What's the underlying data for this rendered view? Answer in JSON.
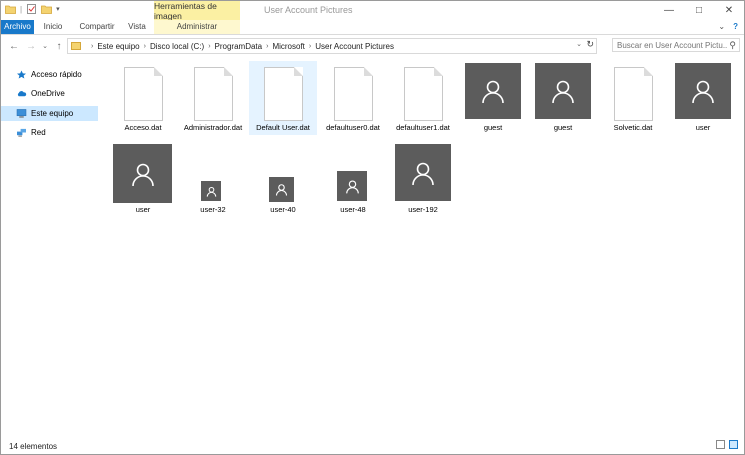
{
  "window": {
    "title": "User Account Pictures",
    "context_tab_header": "Herramientas de imagen"
  },
  "ribbon": {
    "tabs": [
      {
        "label": "Archivo"
      },
      {
        "label": "Inicio"
      },
      {
        "label": "Compartir"
      },
      {
        "label": "Vista"
      },
      {
        "label": "Administrar"
      }
    ]
  },
  "address": {
    "crumbs": [
      "Este equipo",
      "Disco local (C:)",
      "ProgramData",
      "Microsoft",
      "User Account Pictures"
    ]
  },
  "search": {
    "placeholder": "Buscar en User Account Pictu..."
  },
  "sidebar": {
    "items": [
      {
        "label": "Acceso rápido",
        "icon": "star-icon",
        "color": "#1979ca"
      },
      {
        "label": "OneDrive",
        "icon": "cloud-icon",
        "color": "#1979ca"
      },
      {
        "label": "Este equipo",
        "icon": "computer-icon",
        "color": "#3c8fd8"
      },
      {
        "label": "Red",
        "icon": "network-icon",
        "color": "#3c8fd8"
      }
    ]
  },
  "files": [
    {
      "name": "Acceso.dat",
      "kind": "document"
    },
    {
      "name": "Administrador.dat",
      "kind": "document"
    },
    {
      "name": "Default User.dat",
      "kind": "document"
    },
    {
      "name": "defaultuser0.dat",
      "kind": "document"
    },
    {
      "name": "defaultuser1.dat",
      "kind": "document"
    },
    {
      "name": "guest",
      "kind": "avatar"
    },
    {
      "name": "guest",
      "kind": "avatar"
    },
    {
      "name": "Solvetic.dat",
      "kind": "document"
    },
    {
      "name": "user",
      "kind": "avatar"
    },
    {
      "name": "user",
      "kind": "avatar"
    },
    {
      "name": "user-32",
      "kind": "avatar"
    },
    {
      "name": "user-40",
      "kind": "avatar"
    },
    {
      "name": "user-48",
      "kind": "avatar"
    },
    {
      "name": "user-192",
      "kind": "avatar"
    }
  ],
  "status": {
    "count": "14 elementos"
  },
  "colors": {
    "file_tab": "#1979ca",
    "context_header": "#fbf0a3",
    "selection": "#cce8ff",
    "avatar_bg": "#5c5c5c"
  }
}
